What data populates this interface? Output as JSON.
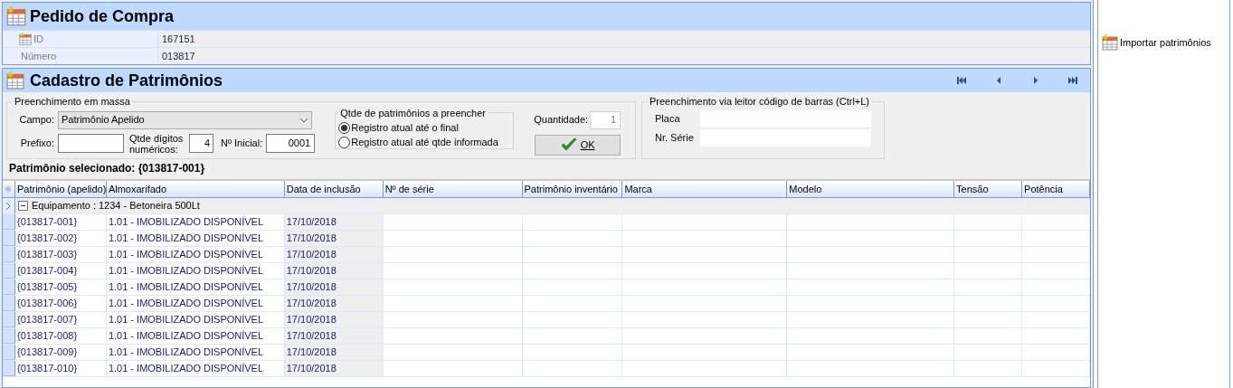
{
  "pedido": {
    "title": "Pedido de Compra",
    "fields": [
      {
        "label": "ID",
        "value": "167151",
        "icon": true
      },
      {
        "label": "Número",
        "value": "013817",
        "icon": false
      }
    ]
  },
  "cadastro": {
    "title": "Cadastro de Patrimônios",
    "massa": {
      "title": "Preenchimento em massa",
      "campo_label": "Campo:",
      "campo_value": "Patrimônio Apelido",
      "prefixo_label": "Prefixo:",
      "digitos_label": "Qtde dígitos numéricos:",
      "digitos_value": "4",
      "inicial_label": "Nº Inicial:",
      "inicial_value": "0001"
    },
    "qtde": {
      "title": "Qtde de patrimônios a preencher",
      "options": [
        {
          "label": "Registro atual até o final",
          "selected": true
        },
        {
          "label": "Registro atual até qtde informada",
          "selected": false
        }
      ]
    },
    "quantidade_label": "Quantidade:",
    "quantidade_value": "1",
    "ok_button": "OK",
    "leitor": {
      "title": "Preenchimento via leitor código de barras (Ctrl+L)",
      "fields": [
        "Placa",
        "Nr. Série"
      ]
    },
    "selecionado": "Patrimônio selecionado: {013817-001}"
  },
  "table": {
    "columns": [
      "Patrimônio (apelido)",
      "Almoxarifado",
      "Data de inclusão",
      "Nº de série",
      "Patrimônio inventário",
      "Marca",
      "Modelo",
      "Tensão",
      "Potência"
    ],
    "group": {
      "label": "Equipamento : 1234 - Betoneira 500Lt",
      "expanded": true
    },
    "rows": [
      [
        "{013817-001}",
        "1.01 - IMOBILIZADO DISPONÍVEL",
        "17/10/2018"
      ],
      [
        "{013817-002}",
        "1.01 - IMOBILIZADO DISPONÍVEL",
        "17/10/2018"
      ],
      [
        "{013817-003}",
        "1.01 - IMOBILIZADO DISPONÍVEL",
        "17/10/2018"
      ],
      [
        "{013817-004}",
        "1.01 - IMOBILIZADO DISPONÍVEL",
        "17/10/2018"
      ],
      [
        "{013817-005}",
        "1.01 - IMOBILIZADO DISPONÍVEL",
        "17/10/2018"
      ],
      [
        "{013817-006}",
        "1.01 - IMOBILIZADO DISPONÍVEL",
        "17/10/2018"
      ],
      [
        "{013817-007}",
        "1.01 - IMOBILIZADO DISPONÍVEL",
        "17/10/2018"
      ],
      [
        "{013817-008}",
        "1.01 - IMOBILIZADO DISPONÍVEL",
        "17/10/2018"
      ],
      [
        "{013817-009}",
        "1.01 - IMOBILIZADO DISPONÍVEL",
        "17/10/2018"
      ],
      [
        "{013817-010}",
        "1.01 - IMOBILIZADO DISPONÍVEL",
        "17/10/2018"
      ]
    ]
  },
  "side": {
    "action": "Importar patrimônios"
  }
}
